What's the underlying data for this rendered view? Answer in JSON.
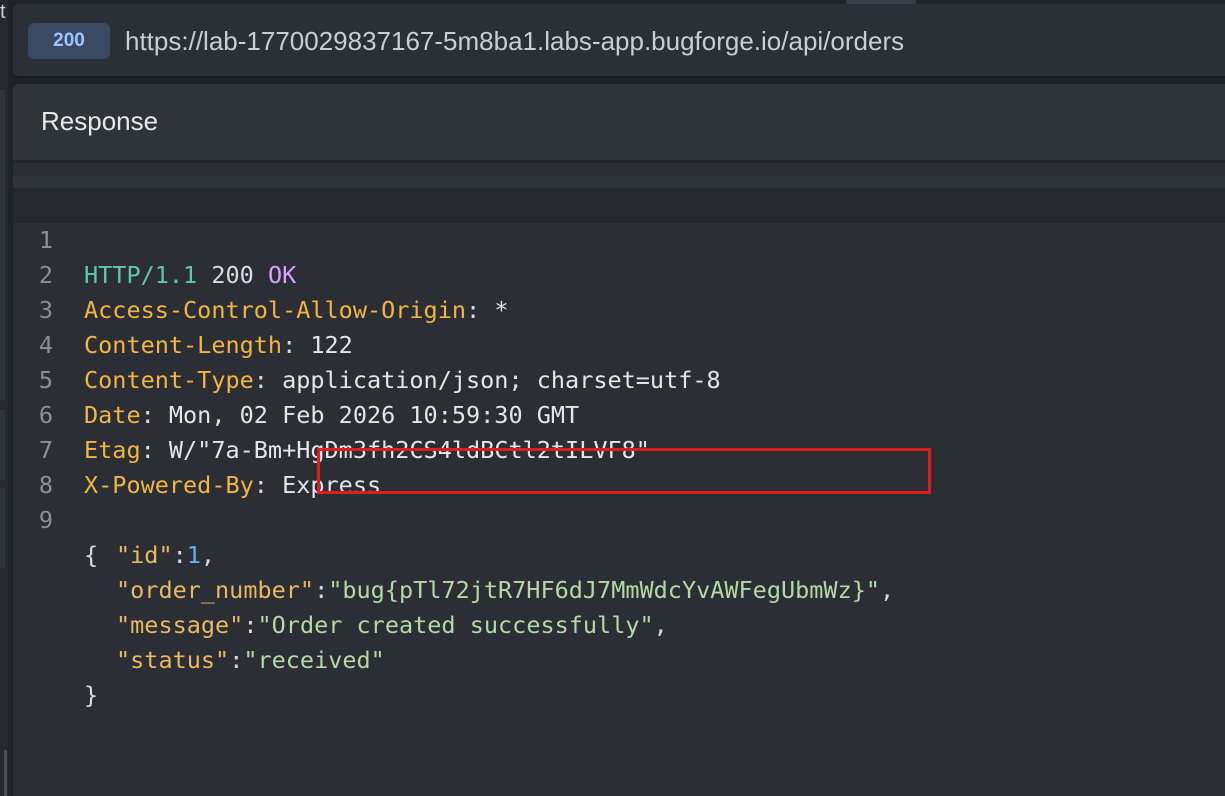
{
  "left_edge": {
    "text": "t"
  },
  "request": {
    "status_code": "200",
    "url": "https://lab-1770029837167-5m8ba1.labs-app.bugforge.io/api/orders"
  },
  "response_panel": {
    "title": "Response"
  },
  "response": {
    "line_numbers": [
      "1",
      "2",
      "3",
      "4",
      "5",
      "6",
      "7",
      "8",
      "9"
    ],
    "status_line": {
      "protocol": "HTTP/1.1",
      "code": "200",
      "reason": "OK"
    },
    "headers": [
      {
        "name": "Access-Control-Allow-Origin",
        "value": "*"
      },
      {
        "name": "Content-Length",
        "value": "122"
      },
      {
        "name": "Content-Type",
        "value": "application/json; charset=utf-8"
      },
      {
        "name": "Date",
        "value": "Mon, 02 Feb 2026 10:59:30 GMT"
      },
      {
        "name": "Etag",
        "value": "W/\"7a-Bm+HgDm3fh2CS4ldBCtl2tILVF8\""
      },
      {
        "name": "X-Powered-By",
        "value": "Express"
      }
    ],
    "body": {
      "open_brace": "{",
      "close_brace": "}",
      "fields": [
        {
          "key": "\"id\"",
          "value": "1",
          "type": "number",
          "trailing": ","
        },
        {
          "key": "\"order_number\"",
          "value": "\"bug{pTl72jtR7HF6dJ7MmWdcYvAWFegUbmWz}\"",
          "type": "string",
          "trailing": ","
        },
        {
          "key": "\"message\"",
          "value": "\"Order created successfully\"",
          "type": "string",
          "trailing": ","
        },
        {
          "key": "\"status\"",
          "value": "\"received\"",
          "type": "string",
          "trailing": ""
        }
      ]
    }
  },
  "colors": {
    "highlight_box": "#e01d1d",
    "status_pill_bg": "#3a4a63",
    "status_pill_text": "#9fc4ff",
    "header_key": "#f2b541",
    "json_string": "#b5d8a6",
    "json_number": "#61afef",
    "protocol": "#5fc9a6",
    "reason": "#d9a0ff"
  }
}
